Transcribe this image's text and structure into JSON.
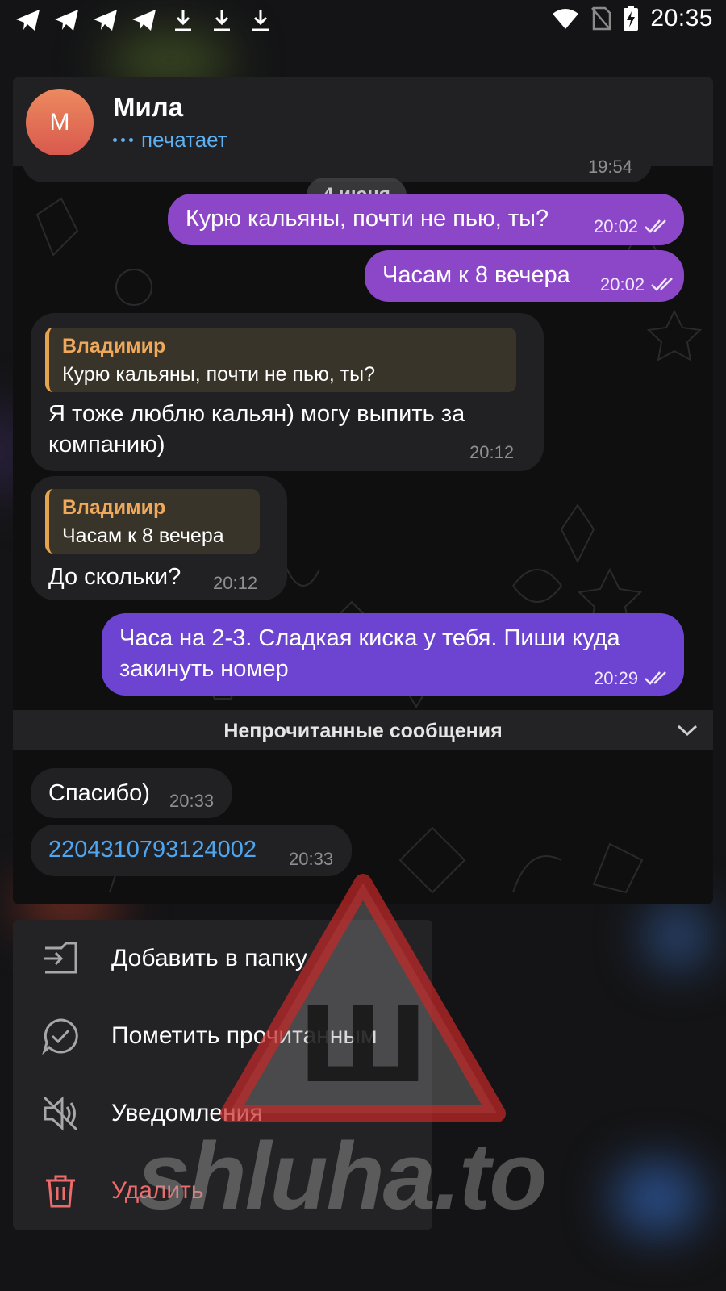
{
  "status_bar": {
    "time": "20:35",
    "left_icons": [
      "telegram-icon",
      "telegram-icon",
      "telegram-icon",
      "telegram-icon",
      "download-icon",
      "download-icon",
      "download-icon"
    ],
    "right_icons": [
      "wifi-icon",
      "no-sim-icon",
      "battery-charging-icon"
    ]
  },
  "header": {
    "avatar_initial": "М",
    "name": "Мила",
    "status": "печатает"
  },
  "chat": {
    "partial_time": "19:54",
    "date_chip": "4 июня",
    "messages": [
      {
        "text": "Курю кальяны, почти не пью, ты?",
        "time": "20:02"
      },
      {
        "text": "Часам к 8 вечера",
        "time": "20:02"
      },
      {
        "reply_name": "Владимир",
        "reply_text": "Курю кальяны, почти не пью, ты?",
        "text_line1": "Я тоже люблю кальян) могу выпить за",
        "text_line2": "компанию)",
        "time": "20:12"
      },
      {
        "reply_name": "Владимир",
        "reply_text": "Часам к 8 вечера",
        "text": "До скольки?",
        "time": "20:12"
      },
      {
        "text_line1": "Часа на 2-3. Сладкая киска у тебя. Пиши куда",
        "text_line2": "закинуть номер",
        "time": "20:29"
      },
      {
        "text": "Спасибо)",
        "time": "20:33"
      },
      {
        "text": "2204310793124002",
        "time": "20:33"
      }
    ],
    "unread_label": "Непрочитанные сообщения"
  },
  "menu": {
    "items": [
      {
        "label": "Добавить в папку",
        "icon": "folder-add-icon"
      },
      {
        "label": "Пометить прочитанным",
        "icon": "chat-check-icon"
      },
      {
        "label": "Уведомления",
        "icon": "mute-icon"
      },
      {
        "label": "Удалить",
        "icon": "trash-icon"
      }
    ]
  },
  "watermark": {
    "text": "shluha.to",
    "sign_letter": "Ш"
  },
  "colors": {
    "outgoing_bubble": "#8b47c8",
    "outgoing_bubble_last": "#6d44d1",
    "incoming_bubble": "#212124",
    "reply_accent": "#e6a44e",
    "link": "#4fa6f0",
    "typing": "#5fb0f0",
    "danger": "#ef6b6b"
  }
}
